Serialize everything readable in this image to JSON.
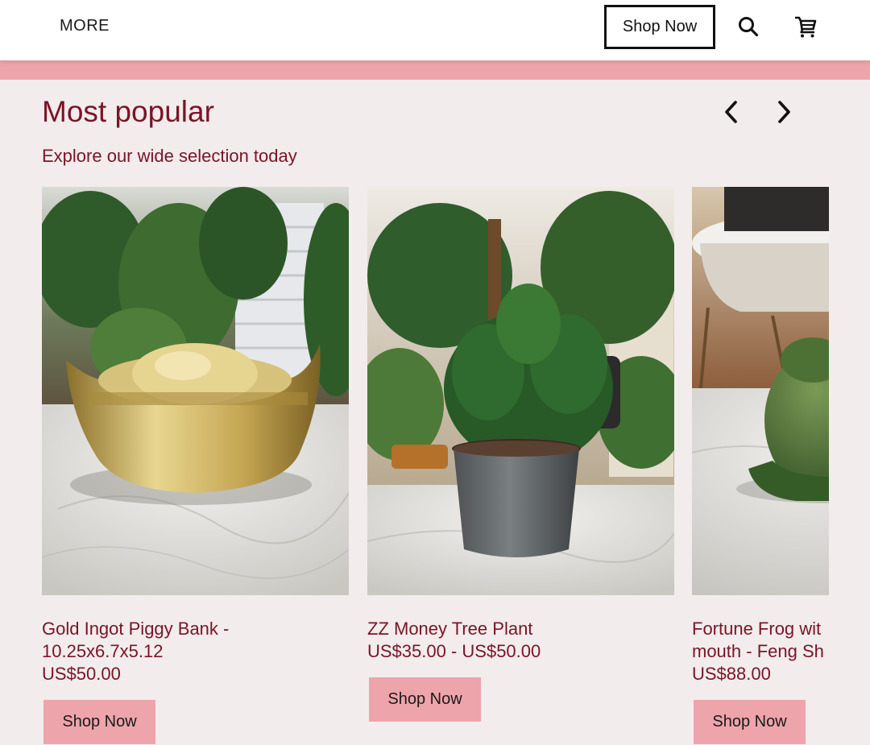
{
  "header": {
    "more_label": "MORE",
    "shop_now_label": "Shop Now",
    "search_icon": "search-icon",
    "cart_icon": "cart-icon"
  },
  "section": {
    "title": "Most popular",
    "subtitle": "Explore our wide selection today",
    "prev_icon": "chevron-left-icon",
    "next_icon": "chevron-right-icon"
  },
  "products": [
    {
      "name": "Gold Ingot Piggy Bank - 10.25x6.7x5.12",
      "price": "US$50.00",
      "button_label": "Shop Now"
    },
    {
      "name": "ZZ Money Tree Plant",
      "price": "US$35.00 - US$50.00",
      "button_label": "Shop Now"
    },
    {
      "name": "Fortune Frog wit mouth - Feng Sh",
      "price": "US$88.00",
      "button_label": "Shop Now"
    }
  ],
  "colors": {
    "accent_pink": "#eea4ab",
    "text_maroon": "#7a1425",
    "page_background": "#f3eced"
  }
}
